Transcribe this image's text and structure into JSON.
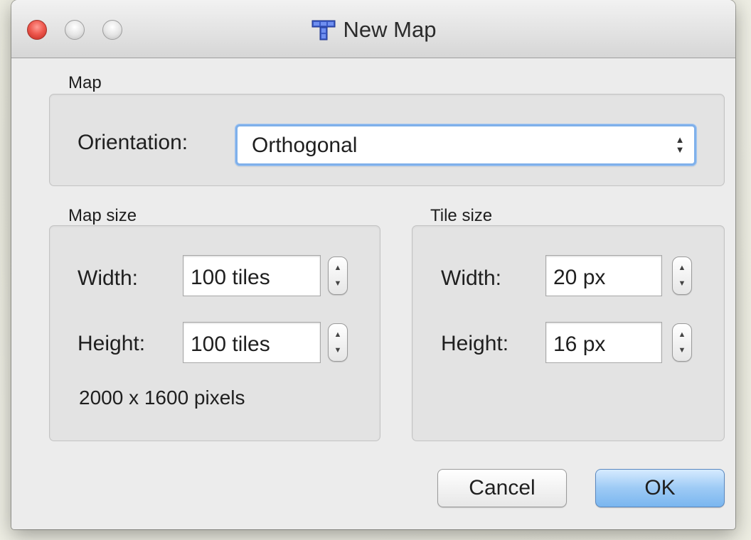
{
  "window": {
    "title": "New Map",
    "app_icon": "tiled-app-icon"
  },
  "map_group": {
    "title": "Map",
    "orientation_label": "Orientation:",
    "orientation_value": "Orthogonal"
  },
  "map_size_group": {
    "title": "Map size",
    "width_label": "Width:",
    "width_value": "100 tiles",
    "height_label": "Height:",
    "height_value": "100 tiles",
    "pixel_summary": "2000 x 1600 pixels"
  },
  "tile_size_group": {
    "title": "Tile size",
    "width_label": "Width:",
    "width_value": "20 px",
    "height_label": "Height:",
    "height_value": "16 px"
  },
  "buttons": {
    "cancel": "Cancel",
    "ok": "OK"
  },
  "colors": {
    "close_button": "#ef5a50",
    "default_button": "#9dcaf5",
    "focus_ring": "#7fb0ea"
  }
}
